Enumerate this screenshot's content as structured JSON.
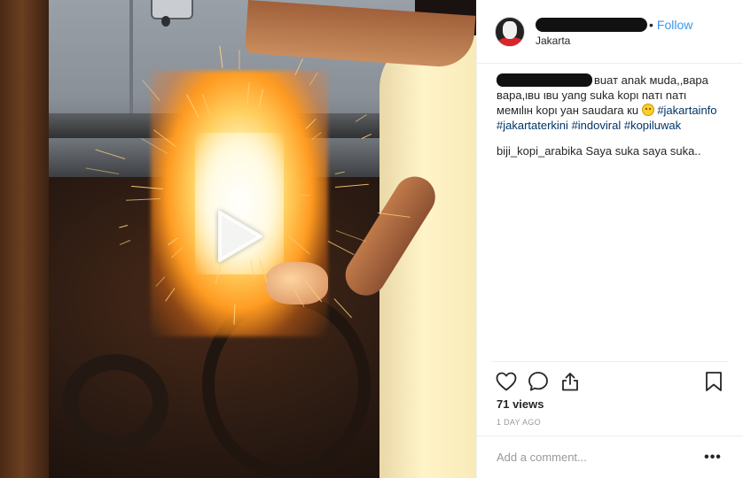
{
  "header": {
    "follow_label": "Follow",
    "separator": "•",
    "location": "Jakarta"
  },
  "caption": {
    "text_after_name": "вuат anak мuda,,вapa вapa,ιвu ιвu yang ѕuka kopι naтι naтι мeмιlιн kopι yaн ѕaudara кu",
    "hashtags": [
      "#jakartainfo",
      "#jakartaterkini",
      "#indoviral",
      "#kopiluwak"
    ]
  },
  "comment": {
    "text": "biji_kopi_arabika Saya suka saya suka.."
  },
  "stats": {
    "views": "71 views",
    "time_ago": "1 DAY AGO"
  },
  "comment_box": {
    "placeholder": "Add a comment...",
    "more_label": "•••"
  },
  "icons": {
    "play": "play-icon",
    "like": "heart-icon",
    "comment": "comment-icon",
    "share": "share-icon",
    "save": "bookmark-icon",
    "more": "more-icon"
  },
  "colors": {
    "follow": "#3897f0",
    "hashtag": "#003569",
    "meta": "#999999",
    "divider": "#efefef"
  }
}
